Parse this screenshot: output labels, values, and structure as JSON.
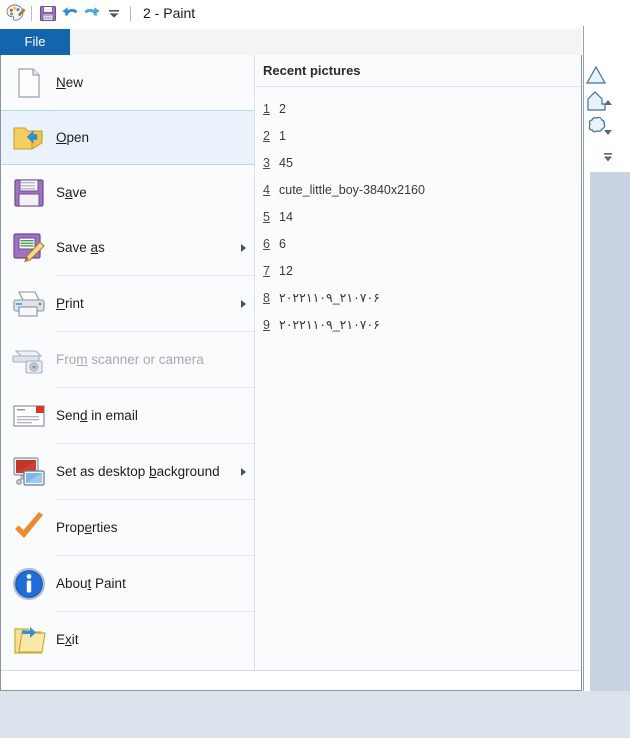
{
  "window": {
    "title": "2 - Paint",
    "app_icon": "paint-palette-icon"
  },
  "quick_access_toolbar": {
    "items": [
      {
        "name": "save-icon",
        "label": "Save"
      },
      {
        "name": "undo-icon",
        "label": "Undo"
      },
      {
        "name": "redo-icon",
        "label": "Redo"
      },
      {
        "name": "customize-quick-access-toolbar-icon",
        "label": "Customize Quick Access Toolbar"
      }
    ]
  },
  "ribbon": {
    "file_tab_label": "File",
    "shapes": [
      {
        "name": "triangle-shape-icon"
      },
      {
        "name": "right-arrow-shape-icon"
      },
      {
        "name": "cloud-callout-shape-icon"
      }
    ],
    "scroll_buttons": [
      {
        "name": "scroll-up-icon"
      },
      {
        "name": "scroll-down-icon"
      },
      {
        "name": "more-shapes-icon"
      }
    ]
  },
  "file_menu": {
    "items": [
      {
        "id": "new",
        "label_before": "",
        "accesskey": "N",
        "label_after": "ew",
        "icon": "new-document-icon",
        "submenu": false,
        "disabled": false,
        "selected": false,
        "separator_after": false
      },
      {
        "id": "open",
        "label_before": "",
        "accesskey": "O",
        "label_after": "pen",
        "icon": "open-folder-icon",
        "submenu": false,
        "disabled": false,
        "selected": true,
        "separator_after": false
      },
      {
        "id": "save",
        "label_before": "S",
        "accesskey": "a",
        "label_after": "ve",
        "icon": "save-floppy-icon",
        "submenu": false,
        "disabled": false,
        "selected": false,
        "separator_after": false
      },
      {
        "id": "save-as",
        "label_before": "Save ",
        "accesskey": "a",
        "label_after": "s",
        "icon": "save-as-floppy-pencil-icon",
        "submenu": true,
        "disabled": false,
        "selected": false,
        "separator_after": true
      },
      {
        "id": "print",
        "label_before": "",
        "accesskey": "P",
        "label_after": "rint",
        "icon": "printer-icon",
        "submenu": true,
        "disabled": false,
        "selected": false,
        "separator_after": true
      },
      {
        "id": "from-scanner-or-camera",
        "label_before": "Fro",
        "accesskey": "m",
        "label_after": " scanner or camera",
        "icon": "scanner-camera-icon",
        "submenu": false,
        "disabled": true,
        "selected": false,
        "separator_after": true
      },
      {
        "id": "send-in-email",
        "label_before": "Sen",
        "accesskey": "d",
        "label_after": " in email",
        "icon": "email-envelope-icon",
        "submenu": false,
        "disabled": false,
        "selected": false,
        "separator_after": true
      },
      {
        "id": "set-as-desktop-background",
        "label_before": "Set as desktop ",
        "accesskey": "b",
        "label_after": "ackground",
        "icon": "desktop-monitors-icon",
        "submenu": true,
        "disabled": false,
        "selected": false,
        "separator_after": true
      },
      {
        "id": "properties",
        "label_before": "Prop",
        "accesskey": "e",
        "label_after": "rties",
        "icon": "orange-checkmark-icon",
        "submenu": false,
        "disabled": false,
        "selected": false,
        "separator_after": true
      },
      {
        "id": "about-paint",
        "label_before": "Abou",
        "accesskey": "t",
        "label_after": " Paint",
        "icon": "info-circle-icon",
        "submenu": false,
        "disabled": false,
        "selected": false,
        "separator_after": true
      },
      {
        "id": "exit",
        "label_before": "E",
        "accesskey": "x",
        "label_after": "it",
        "icon": "exit-folder-arrow-icon",
        "submenu": false,
        "disabled": false,
        "selected": false,
        "separator_after": false
      }
    ]
  },
  "recent_pictures": {
    "title": "Recent pictures",
    "items": [
      {
        "number": "1",
        "name": "2"
      },
      {
        "number": "2",
        "name": "1"
      },
      {
        "number": "3",
        "name": "45"
      },
      {
        "number": "4",
        "name": "cute_little_boy-3840x2160"
      },
      {
        "number": "5",
        "name": "14"
      },
      {
        "number": "6",
        "name": "6"
      },
      {
        "number": "7",
        "name": "12"
      },
      {
        "number": "8",
        "name": "۲۰۲۲۱۱۰۹_۲۱۰۷۰۶"
      },
      {
        "number": "9",
        "name": "۲۰۲۲۱۱۰۹_۲۱۰۷۰۶"
      }
    ]
  },
  "colors": {
    "file_tab_blue": "#1366ab",
    "selection_blue": "#eaf3fb",
    "selection_border": "#b9d8ef",
    "desktop": "#dde3ec",
    "panel_bg": "#fafbfc",
    "text": "#1d1d1d",
    "disabled_text": "#a6a9ae"
  }
}
